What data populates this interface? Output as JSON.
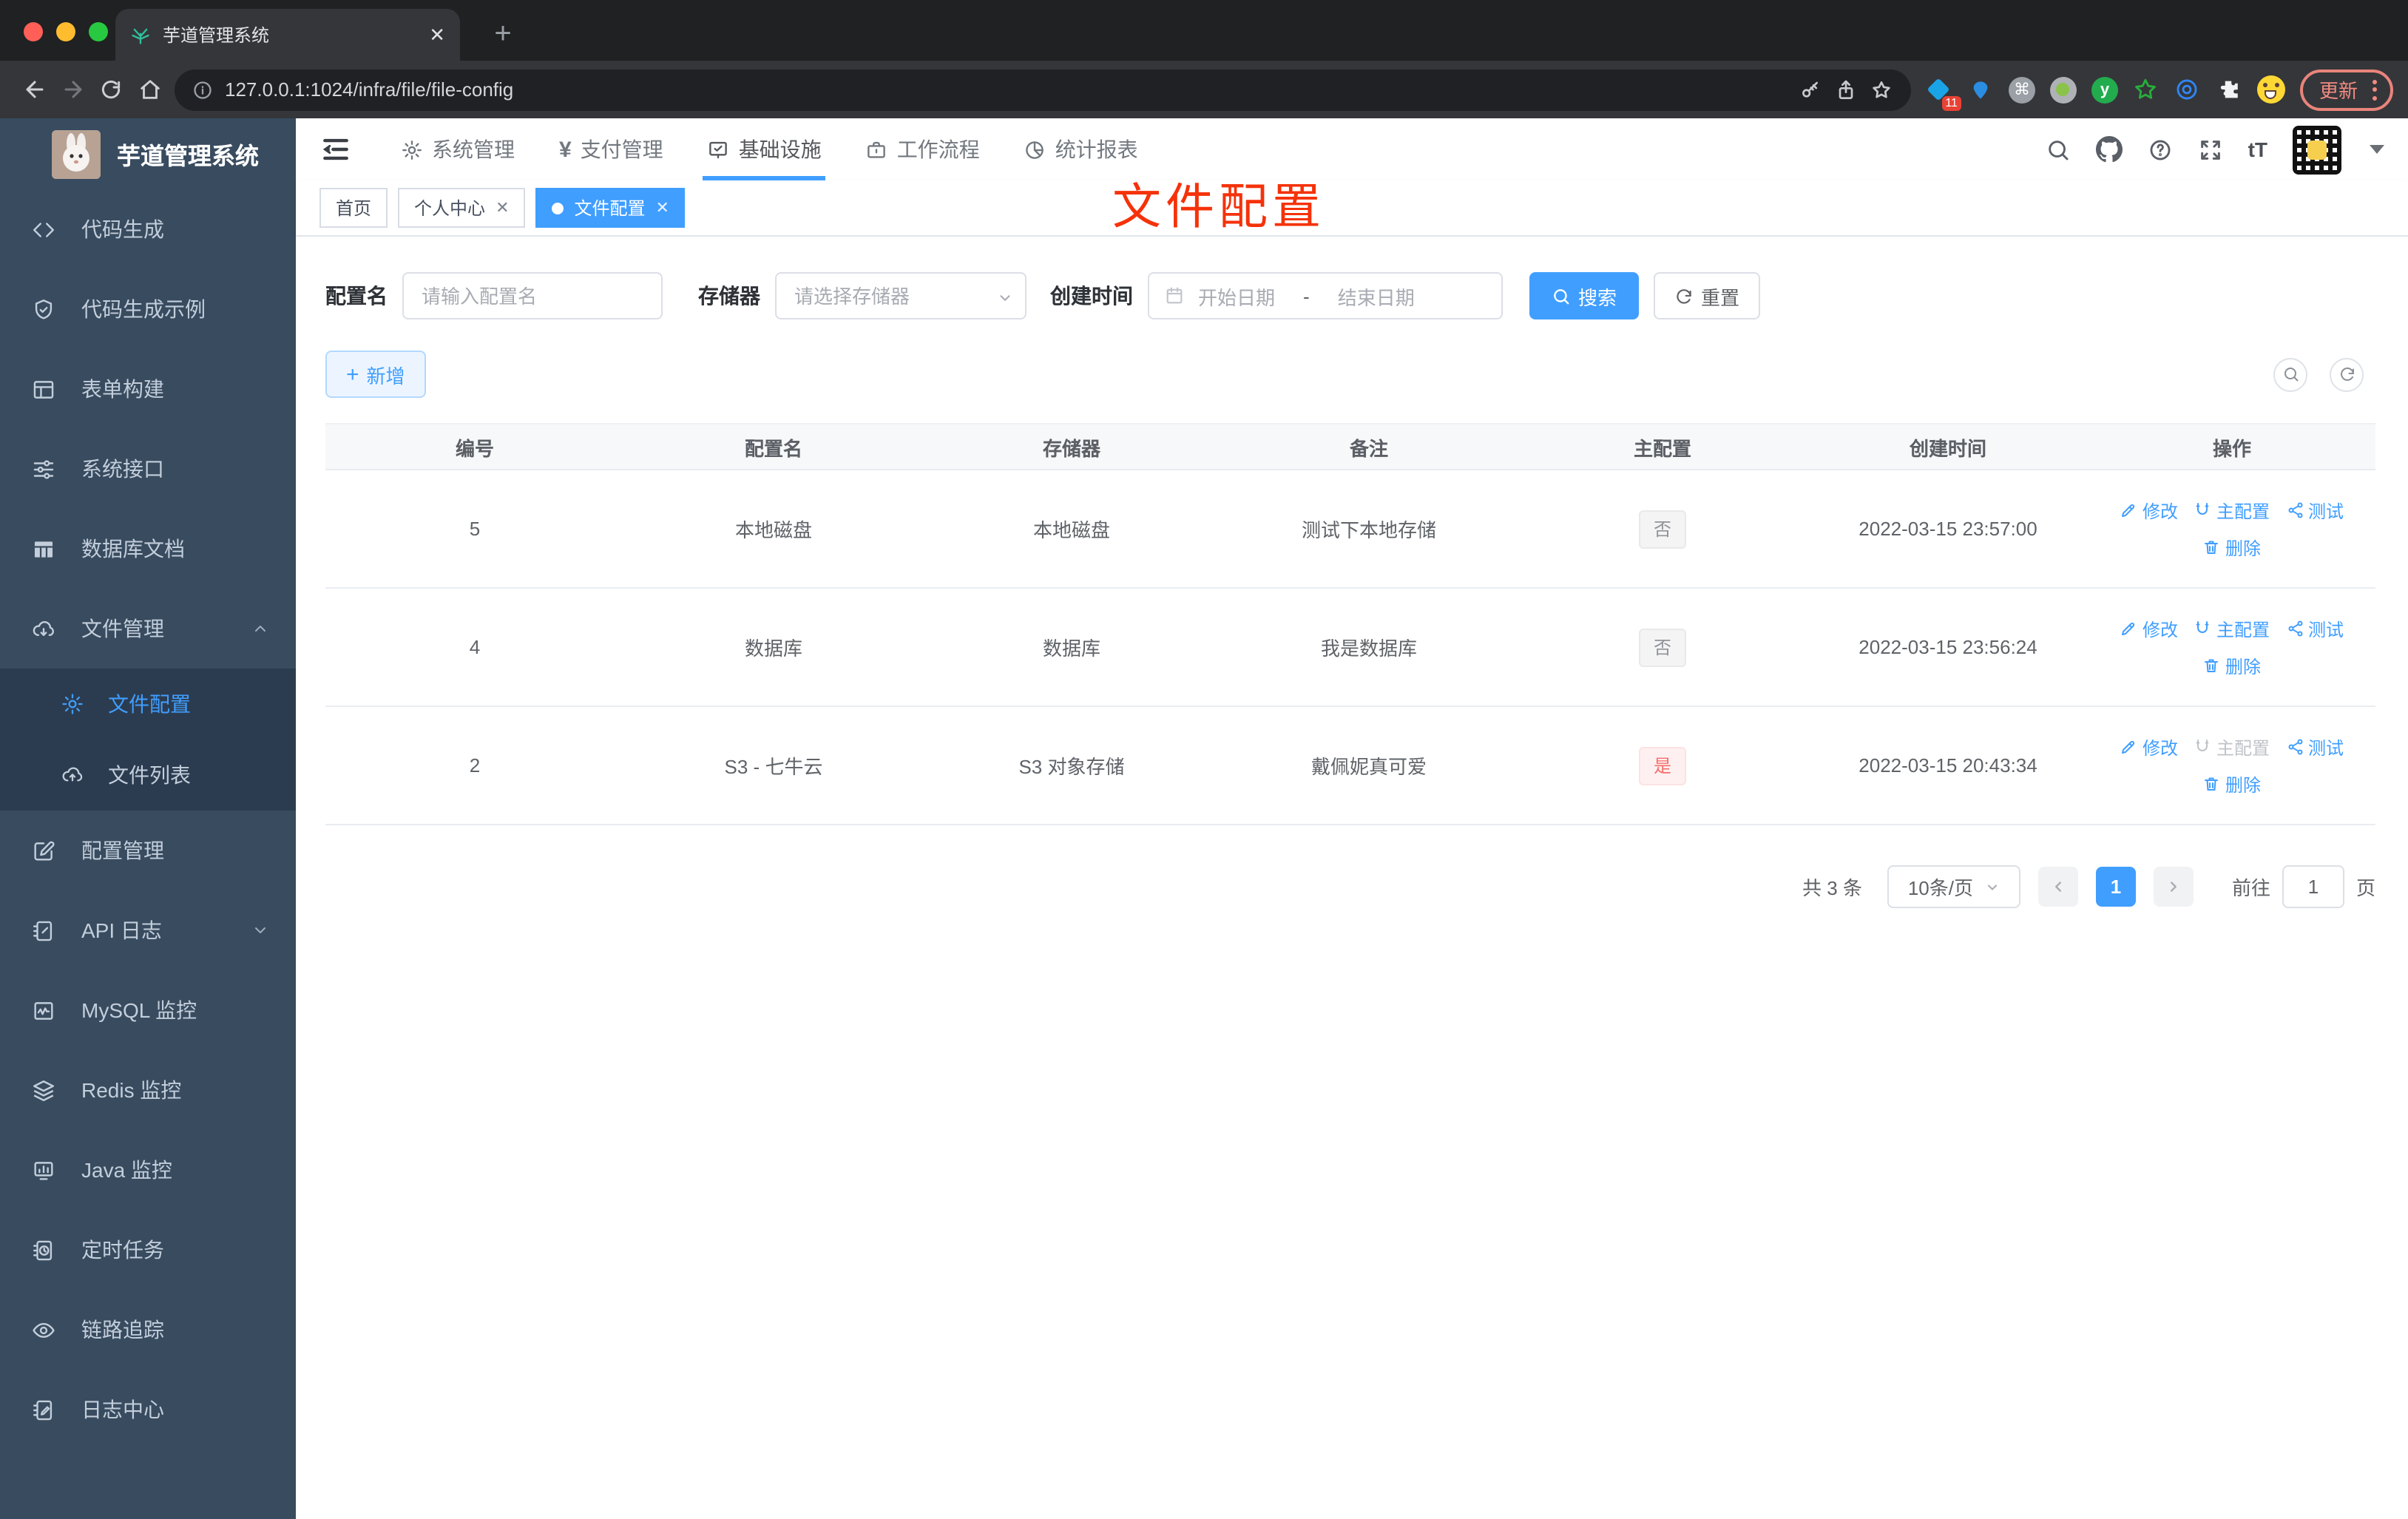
{
  "browser": {
    "tab_title": "芋道管理系统",
    "url": "127.0.0.1:1024/infra/file/file-config",
    "update_label": "更新",
    "extension_badge": "11"
  },
  "sidebar": {
    "app_title": "芋道管理系统",
    "items": [
      {
        "label": "代码生成"
      },
      {
        "label": "代码生成示例"
      },
      {
        "label": "表单构建"
      },
      {
        "label": "系统接口"
      },
      {
        "label": "数据库文档"
      },
      {
        "label": "文件管理"
      },
      {
        "label": "文件配置"
      },
      {
        "label": "文件列表"
      },
      {
        "label": "配置管理"
      },
      {
        "label": "API 日志"
      },
      {
        "label": "MySQL 监控"
      },
      {
        "label": "Redis 监控"
      },
      {
        "label": "Java 监控"
      },
      {
        "label": "定时任务"
      },
      {
        "label": "链路追踪"
      },
      {
        "label": "日志中心"
      }
    ]
  },
  "topnav": {
    "items": [
      {
        "label": "系统管理"
      },
      {
        "label": "支付管理"
      },
      {
        "label": "基础设施"
      },
      {
        "label": "工作流程"
      },
      {
        "label": "统计报表"
      }
    ]
  },
  "tabs": [
    {
      "label": "首页"
    },
    {
      "label": "个人中心"
    },
    {
      "label": "文件配置"
    }
  ],
  "annotation": {
    "text": "文件配置",
    "color": "#f5320a"
  },
  "filter": {
    "name_label": "配置名",
    "name_placeholder": "请输入配置名",
    "storage_label": "存储器",
    "storage_placeholder": "请选择存储器",
    "time_label": "创建时间",
    "start_placeholder": "开始日期",
    "range_separator": "-",
    "end_placeholder": "结束日期",
    "search_label": "搜索",
    "reset_label": "重置"
  },
  "toolbar": {
    "add_label": "新增"
  },
  "table": {
    "columns": [
      "编号",
      "配置名",
      "存储器",
      "备注",
      "主配置",
      "创建时间",
      "操作"
    ],
    "row_actions": {
      "edit": "修改",
      "master": "主配置",
      "test": "测试",
      "del": "删除"
    },
    "rows": [
      {
        "id": "5",
        "name": "本地磁盘",
        "storage": "本地磁盘",
        "remark": "测试下本地存储",
        "master": "否",
        "created": "2022-03-15 23:57:00"
      },
      {
        "id": "4",
        "name": "数据库",
        "storage": "数据库",
        "remark": "我是数据库",
        "master": "否",
        "created": "2022-03-15 23:56:24"
      },
      {
        "id": "2",
        "name": "S3 - 七牛云",
        "storage": "S3 对象存储",
        "remark": "戴佩妮真可爱",
        "master": "是",
        "created": "2022-03-15 20:43:34"
      }
    ]
  },
  "pagination": {
    "total_label": "共 3 条",
    "size_label": "10条/页",
    "current_page": "1",
    "goto_label": "前往",
    "goto_value": "1",
    "page_unit": "页"
  },
  "colors": {
    "primary": "#409eff",
    "danger": "#f56c6c",
    "annotation_red": "#f5320a",
    "sidebar_bg": "#384b5f"
  }
}
